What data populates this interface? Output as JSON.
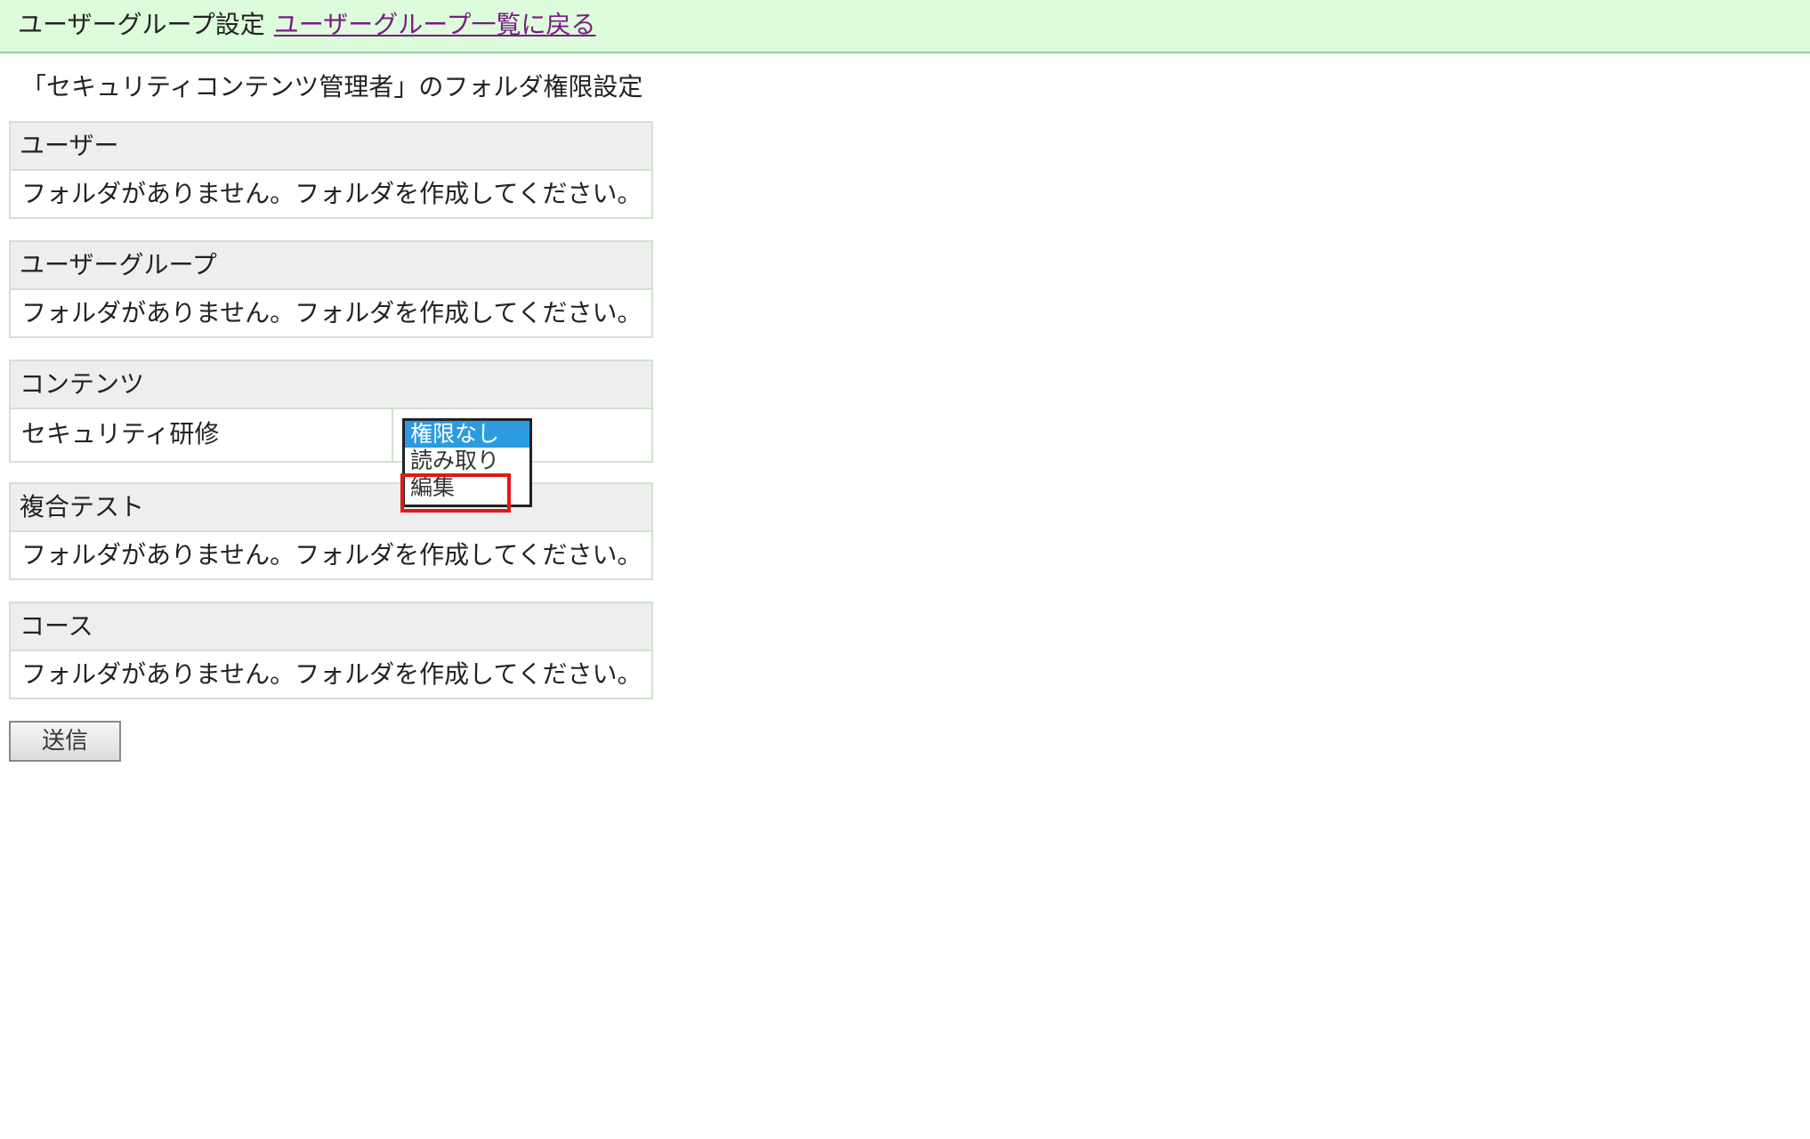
{
  "header": {
    "title": "ユーザーグループ設定",
    "back_link": "ユーザーグループ一覧に戻る"
  },
  "page_heading": "「セキュリティコンテンツ管理者」のフォルダ権限設定",
  "sections": [
    {
      "title": "ユーザー",
      "message": "フォルダがありません。フォルダを作成してください。"
    },
    {
      "title": "ユーザーグループ",
      "message": "フォルダがありません。フォルダを作成してください。"
    },
    {
      "title": "コンテンツ",
      "rows": [
        {
          "name": "セキュリティ研修"
        }
      ]
    },
    {
      "title": "複合テスト",
      "message": "フォルダがありません。フォルダを作成してください。"
    },
    {
      "title": "コース",
      "message": "フォルダがありません。フォルダを作成してください。"
    }
  ],
  "permission_options": [
    "権限なし",
    "読み取り",
    "編集"
  ],
  "permission_selected": "権限なし",
  "colors": {
    "header_bg": "#ddfcdb",
    "link": "#7a1a86",
    "selected_option": "#2c9be0",
    "highlight": "#e01818"
  },
  "submit_label": "送信"
}
